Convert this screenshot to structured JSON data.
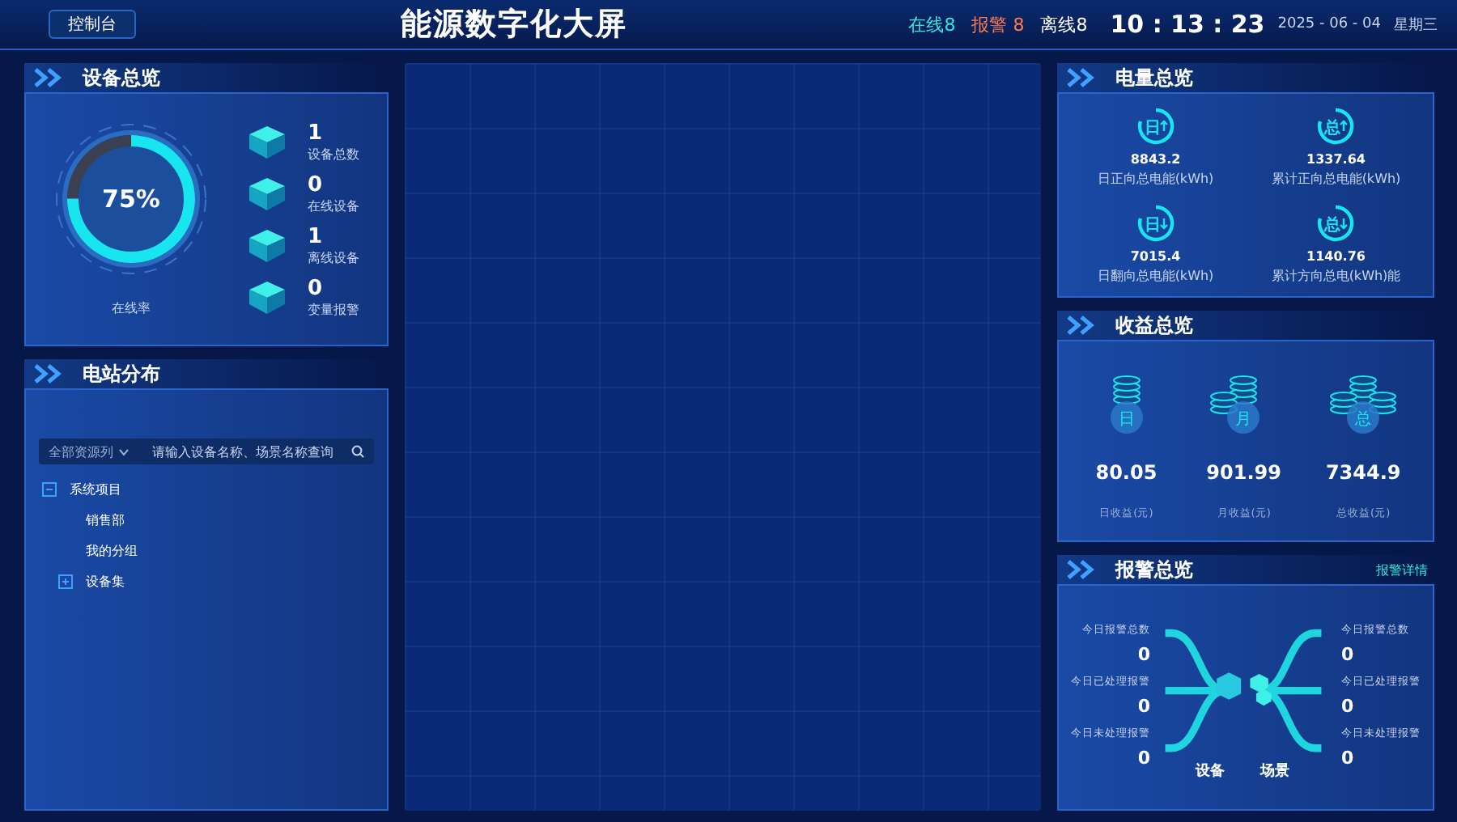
{
  "header": {
    "console_button": "控制台",
    "title": "能源数字化大屏",
    "online": "在线8",
    "alarm": "报警 8",
    "offline": "离线8",
    "time": "10 : 13 : 23",
    "date": "2025 - 06 - 04",
    "weekday": "星期三"
  },
  "device_overview": {
    "title": "设备总览",
    "online_rate": {
      "reading": "75%",
      "level": 0.75,
      "label": "在线率"
    },
    "stats": [
      {
        "value": "1",
        "label": "设备总数"
      },
      {
        "value": "0",
        "label": "在线设备"
      },
      {
        "value": "1",
        "label": "离线设备"
      },
      {
        "value": "0",
        "label": "变量报警"
      }
    ]
  },
  "station_distribution": {
    "title": "电站分布",
    "filter": "全部资源列",
    "search": {
      "placeholder": "请输入设备名称、场景名称查询"
    },
    "tree": [
      {
        "label": "系统项目",
        "kind": "group",
        "expanded": true,
        "children": [
          {
            "label": "销售部",
            "kind": "leaf"
          },
          {
            "label": "我的分组",
            "kind": "leaf"
          },
          {
            "label": "设备集",
            "kind": "group",
            "expanded": false
          }
        ]
      }
    ]
  },
  "power_overview": {
    "title": "电量总览",
    "items": [
      {
        "glyph": "日",
        "upward": true,
        "value": "8843.2",
        "label": "日正向总电能(kWh)"
      },
      {
        "glyph": "总",
        "upward": true,
        "value": "1337.64",
        "label": "累计正向总电能(kWh)"
      },
      {
        "glyph": "日",
        "upward": false,
        "value": "7015.4",
        "label": "日翻向总电能(kWh)"
      },
      {
        "glyph": "总",
        "upward": false,
        "value": "1140.76",
        "label": "累计方向总电(kWh)能"
      }
    ]
  },
  "income_overview": {
    "title": "收益总览",
    "items": [
      {
        "glyph": "日",
        "value": "80.05",
        "label": "日收益(元)"
      },
      {
        "glyph": "月",
        "value": "901.99",
        "label": "月收益(元)"
      },
      {
        "glyph": "总",
        "value": "7344.9",
        "label": "总收益(元)"
      }
    ]
  },
  "alarm_overview": {
    "title": "报警总览",
    "details_link": "报警详情",
    "device_label": "设备",
    "scene_label": "场景",
    "device_stats": [
      {
        "label": "今日报警总数",
        "value": "0"
      },
      {
        "label": "今日已处理报警",
        "value": "0"
      },
      {
        "label": "今日未处理报警",
        "value": "0"
      }
    ],
    "scene_stats": [
      {
        "label": "今日报警总数",
        "value": "0"
      },
      {
        "label": "今日已处理报警",
        "value": "0"
      },
      {
        "label": "今日未处理报警",
        "value": "0"
      }
    ]
  }
}
